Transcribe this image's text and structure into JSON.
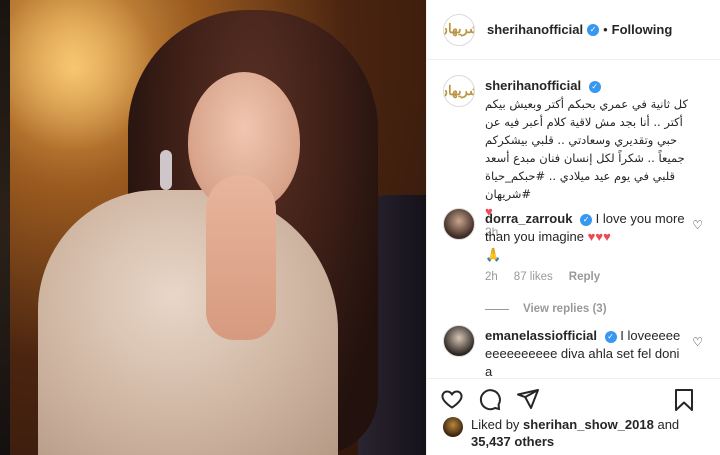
{
  "post": {
    "username": "sherihanofficial",
    "separator": "•",
    "follow_state": "Following",
    "logo_mark": "شريهان"
  },
  "caption": {
    "username": "sherihanofficial",
    "text": "كل ثانية في عمري بحبكم أكتر وبعيش بيكم أكتر .. أنا بجد مش لاقية كلام أعبر فيه عن حبي وتقديري وسعادتي .. قلبي بيشكركم جميعاً .. شكراً لكل إنسان فنان مبدع أسعد قلبي في يوم عيد ميلادي .. #حبكم_حياة #شريهان",
    "heart": "♥",
    "time": "2h"
  },
  "comments": [
    {
      "username": "dorra_zarrouk",
      "text": "I love you more than you imagine",
      "hearts": "♥♥♥",
      "emoji": "🙏",
      "time": "2h",
      "likes": "87 likes",
      "reply": "Reply",
      "view_replies": "View replies (3)"
    },
    {
      "username": "emanelassiofficial",
      "text": "I loveeeeeeeeeeeeeee diva ahla set fel donia"
    }
  ],
  "likes_line": {
    "prefix": "Liked by",
    "user": "sherihan_show_2018",
    "middle": "and",
    "count": "35,437 others"
  },
  "icons": {
    "like": "heart-outline-icon",
    "comment": "comment-icon",
    "share": "share-icon",
    "save": "bookmark-icon",
    "verified": "verified-badge-icon"
  },
  "colors": {
    "verified": "#3897f0",
    "heart": "#ed4956",
    "muted": "#999999"
  }
}
